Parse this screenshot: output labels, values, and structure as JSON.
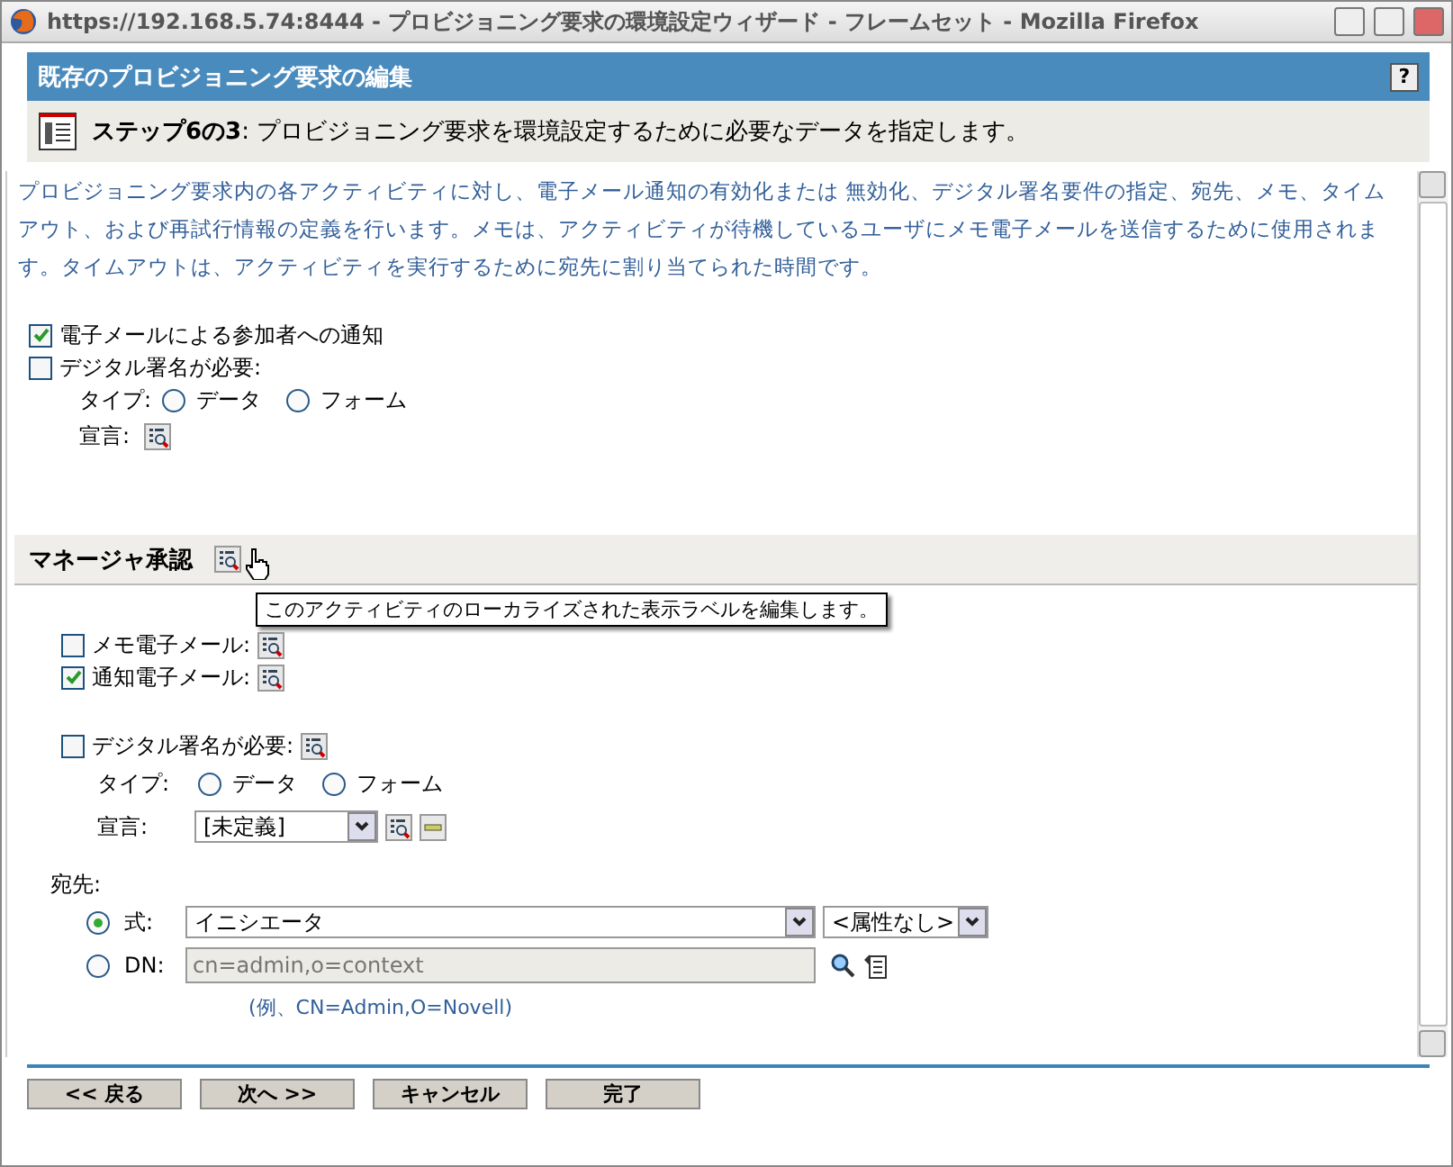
{
  "window": {
    "title": "https://192.168.5.74:8444 - プロビジョニング要求の環境設定ウィザード - フレームセット - Mozilla Firefox"
  },
  "header": {
    "title": "既存のプロビジョニング要求の編集",
    "help": "?"
  },
  "step": {
    "text": "**ステップ6の3**:  プロビジョニング要求を環境設定するために必要なデータを指定します。"
  },
  "description": "プロビジョニング要求内の各アクティビティに対し、電子メール通知の有効化または 無効化、デジタル署名要件の指定、宛先、メモ、タイムアウト、および再試行情報の定義を行います。メモは、アクティビティが待機しているユーザにメモ電子メールを送信するために使用されます。タイムアウトは、アクティビティを実行するために宛先に割り当てられた時間です。",
  "global_options": [
    {
      "label": "電子メールによる参加者への通知",
      "checked": true
    },
    {
      "label": "デジタル署名が必要:",
      "checked": false
    }
  ],
  "global_signature": {
    "type_label": "タイプ:",
    "types": [
      {
        "label": "データ",
        "selected": false
      },
      {
        "label": "フォーム",
        "selected": false
      }
    ],
    "declaration_label": "宣言:"
  },
  "section": {
    "title": "マネージャ承認",
    "tooltip": "このアクティビティのローカライズされた表示ラベルを編集します。",
    "emails": [
      {
        "label": "メモ電子メール:",
        "checked": false
      },
      {
        "label": "通知電子メール:",
        "checked": true
      }
    ],
    "signature": {
      "label": "デジタル署名が必要:",
      "checked": false,
      "type_label": "タイプ:",
      "types": [
        {
          "label": "データ",
          "selected": false
        },
        {
          "label": "フォーム",
          "selected": false
        }
      ],
      "declaration_label": "宣言:",
      "declaration_value": "[未定義]"
    },
    "recipient": {
      "label": "宛先:",
      "options": [
        {
          "label": "式:",
          "selected": true,
          "value": "イニシエータ",
          "attribute": "<属性なし>"
        },
        {
          "label": "DN:",
          "selected": false,
          "placeholder": "cn=admin,o=context"
        }
      ],
      "example": "(例、CN=Admin,O=Novell)"
    }
  },
  "buttons": [
    "<< 戻る",
    "次へ >>",
    "キャンセル",
    "完了"
  ]
}
